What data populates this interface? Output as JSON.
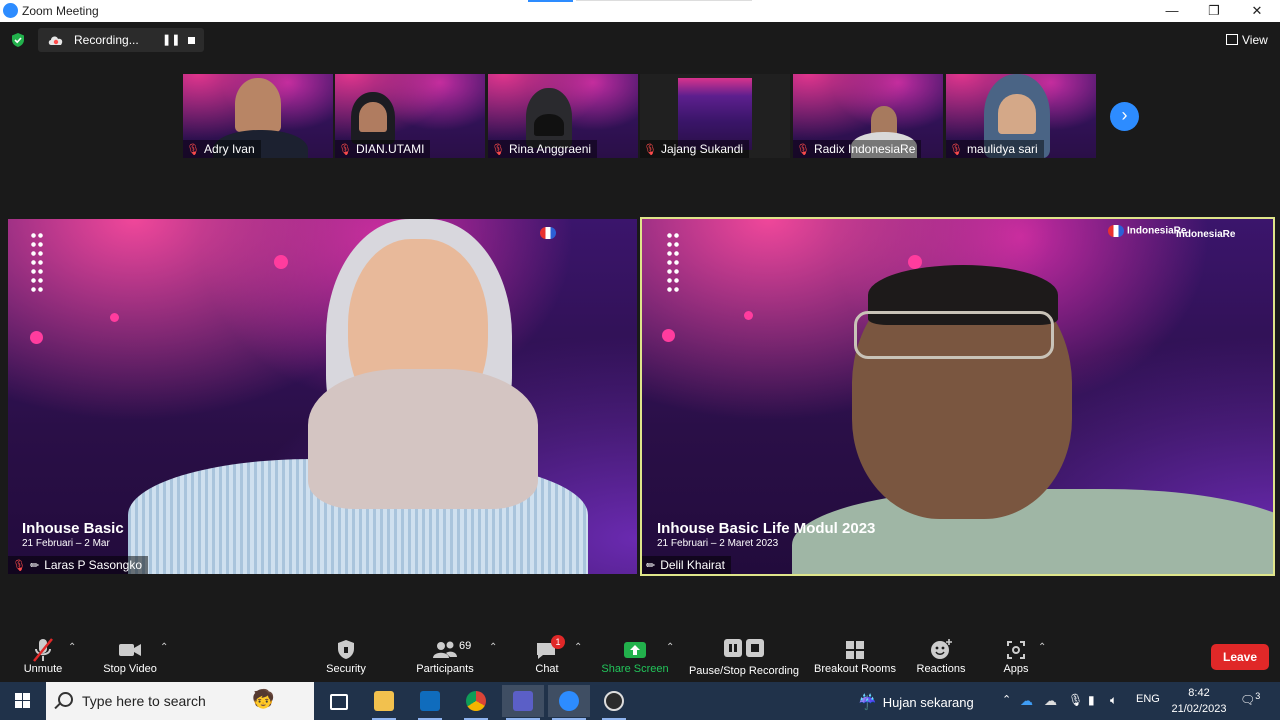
{
  "window": {
    "title": "Zoom Meeting",
    "controls": [
      "minimize",
      "restore",
      "close"
    ]
  },
  "meeting_top": {
    "recording_label": "Recording...",
    "view_label": "View"
  },
  "thumbnails": [
    {
      "name": "Adry Ivan",
      "muted": true
    },
    {
      "name": "DIAN.UTAMI",
      "muted": true
    },
    {
      "name": "Rina Anggraeni",
      "muted": true
    },
    {
      "name": "Jajang Sukandi",
      "muted": true
    },
    {
      "name": "Radix IndonesiaRe",
      "muted": true
    },
    {
      "name": "maulidya sari",
      "muted": true
    }
  ],
  "videos": [
    {
      "name": "Laras P Sasongko",
      "muted": true,
      "pinned": true,
      "overlay_title": "Inhouse Basic",
      "overlay_date": "21 Februari – 2 Mar"
    },
    {
      "name": "Delil Khairat",
      "muted": false,
      "pinned": true,
      "active_speaker": true,
      "overlay_title": "Inhouse Basic Life Modul 2023",
      "overlay_date": "21 Februari – 2 Maret 2023",
      "logo_left": "IndonesiaRe",
      "logo_right": "IndonesiaRe"
    }
  ],
  "toolbar": {
    "unmute": "Unmute",
    "stop_video": "Stop Video",
    "security": "Security",
    "participants": "Participants",
    "participants_count": "69",
    "chat": "Chat",
    "chat_badge": "1",
    "share_screen": "Share Screen",
    "pause_stop_recording": "Pause/Stop Recording",
    "breakout_rooms": "Breakout Rooms",
    "reactions": "Reactions",
    "apps": "Apps",
    "leave": "Leave"
  },
  "taskbar": {
    "search_placeholder": "Type here to search",
    "weather": "Hujan sekarang",
    "language": "ENG",
    "time": "8:42",
    "date": "21/02/2023",
    "notification_count": "3"
  },
  "colors": {
    "zoom_blue": "#2d8cff",
    "share_green": "#22b14c",
    "leave_red": "#e02828",
    "speaker_highlight": "#dfe58a",
    "taskbar": "#20324a"
  }
}
